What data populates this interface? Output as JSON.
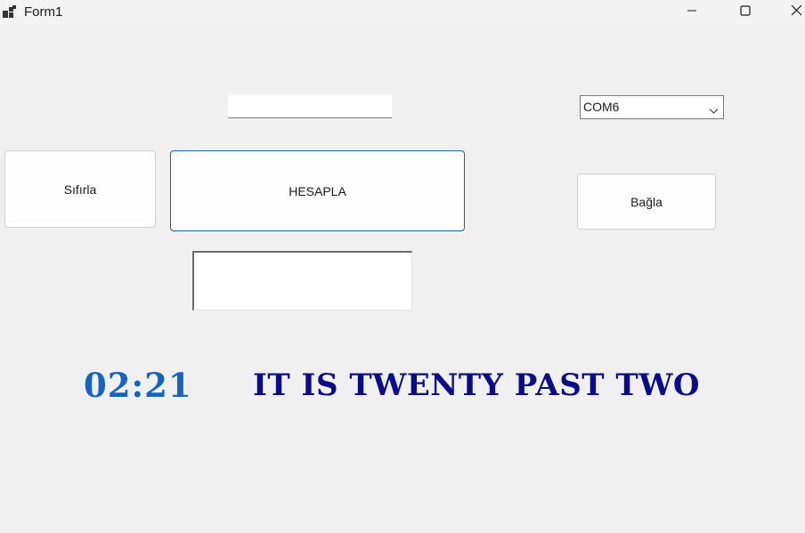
{
  "window": {
    "title": "Form1",
    "controls": {
      "minimize_icon": "minimize-icon",
      "maximize_icon": "maximize-icon",
      "close_icon": "close-icon"
    }
  },
  "form": {
    "top_input": {
      "value": ""
    },
    "port_select": {
      "selected": "COM6"
    },
    "reset_button": {
      "label": "Sıfırla"
    },
    "calculate_button": {
      "label": "HESAPLA"
    },
    "connect_button": {
      "label": "Bağla"
    },
    "result_box": {
      "value": ""
    },
    "time_label": {
      "text": "02:21"
    },
    "time_words_label": {
      "text": "IT IS TWENTY PAST TWO"
    }
  },
  "colors": {
    "time_color": "#1565c0",
    "words_color": "#0a0a8c",
    "accent_border": "#0067c0"
  }
}
